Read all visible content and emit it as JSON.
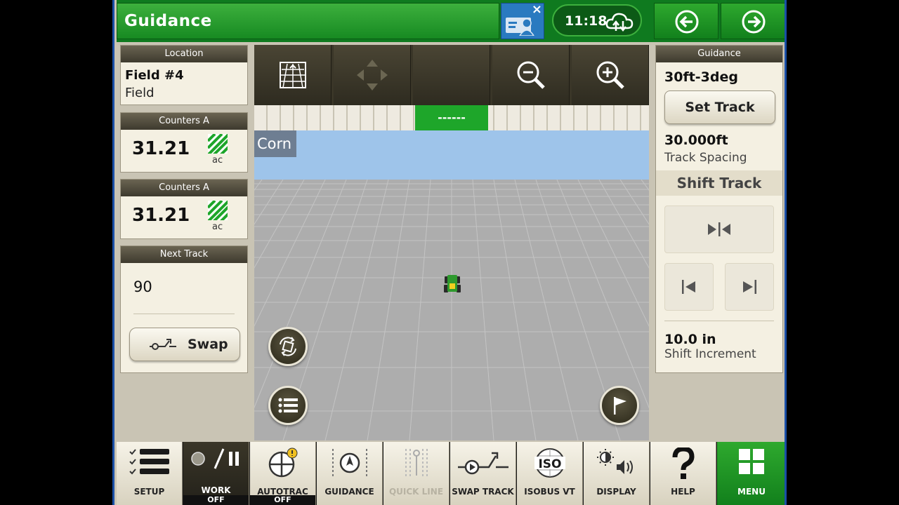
{
  "header": {
    "title": "Guidance",
    "clock": "11:18",
    "operator_close": "×"
  },
  "location": {
    "heading": "Location",
    "name": "Field #4",
    "type": "Field"
  },
  "counters": [
    {
      "heading": "Counters A",
      "value": "31.21",
      "unit": "ac"
    },
    {
      "heading": "Counters A",
      "value": "31.21",
      "unit": "ac"
    }
  ],
  "next_track": {
    "heading": "Next Track",
    "value": "90",
    "swap_label": "Swap"
  },
  "guidance": {
    "heading": "Guidance",
    "track_name": "30ft-3deg",
    "set_track_label": "Set Track",
    "spacing_value": "30.000ft",
    "spacing_label": "Track Spacing",
    "shift_heading": "Shift Track",
    "increment_value": "10.0 in",
    "increment_label": "Shift Increment"
  },
  "map": {
    "lightbar_center": "------",
    "crop_label": "Corn"
  },
  "bottom_bar": [
    {
      "label": "SETUP",
      "status": ""
    },
    {
      "label": "WORK",
      "status": "OFF"
    },
    {
      "label": "AUTOTRAC",
      "status": "OFF"
    },
    {
      "label": "GUIDANCE",
      "status": ""
    },
    {
      "label": "QUICK LINE",
      "status": ""
    },
    {
      "label": "SWAP TRACK",
      "status": ""
    },
    {
      "label": "ISOBUS VT",
      "status": ""
    },
    {
      "label": "DISPLAY",
      "status": ""
    },
    {
      "label": "HELP",
      "status": ""
    },
    {
      "label": "MENU",
      "status": ""
    }
  ],
  "icons": {
    "header": [
      "operator-icon",
      "cloud-sync-icon",
      "arrow-left-icon",
      "arrow-right-icon"
    ],
    "map_toolbar": [
      "grid-view-icon",
      "pan-icon",
      "zoom-out-icon",
      "zoom-in-icon"
    ],
    "map_buttons": [
      "rotate-view-icon",
      "list-icon",
      "flag-icon"
    ]
  },
  "colors": {
    "brand_green": "#178a22",
    "panel_bg": "#f4f0e2",
    "panel_header": "#3e3a2e",
    "lightbar_on": "#1ea62a",
    "sky": "#9ec4ea",
    "ground": "#adadad"
  }
}
